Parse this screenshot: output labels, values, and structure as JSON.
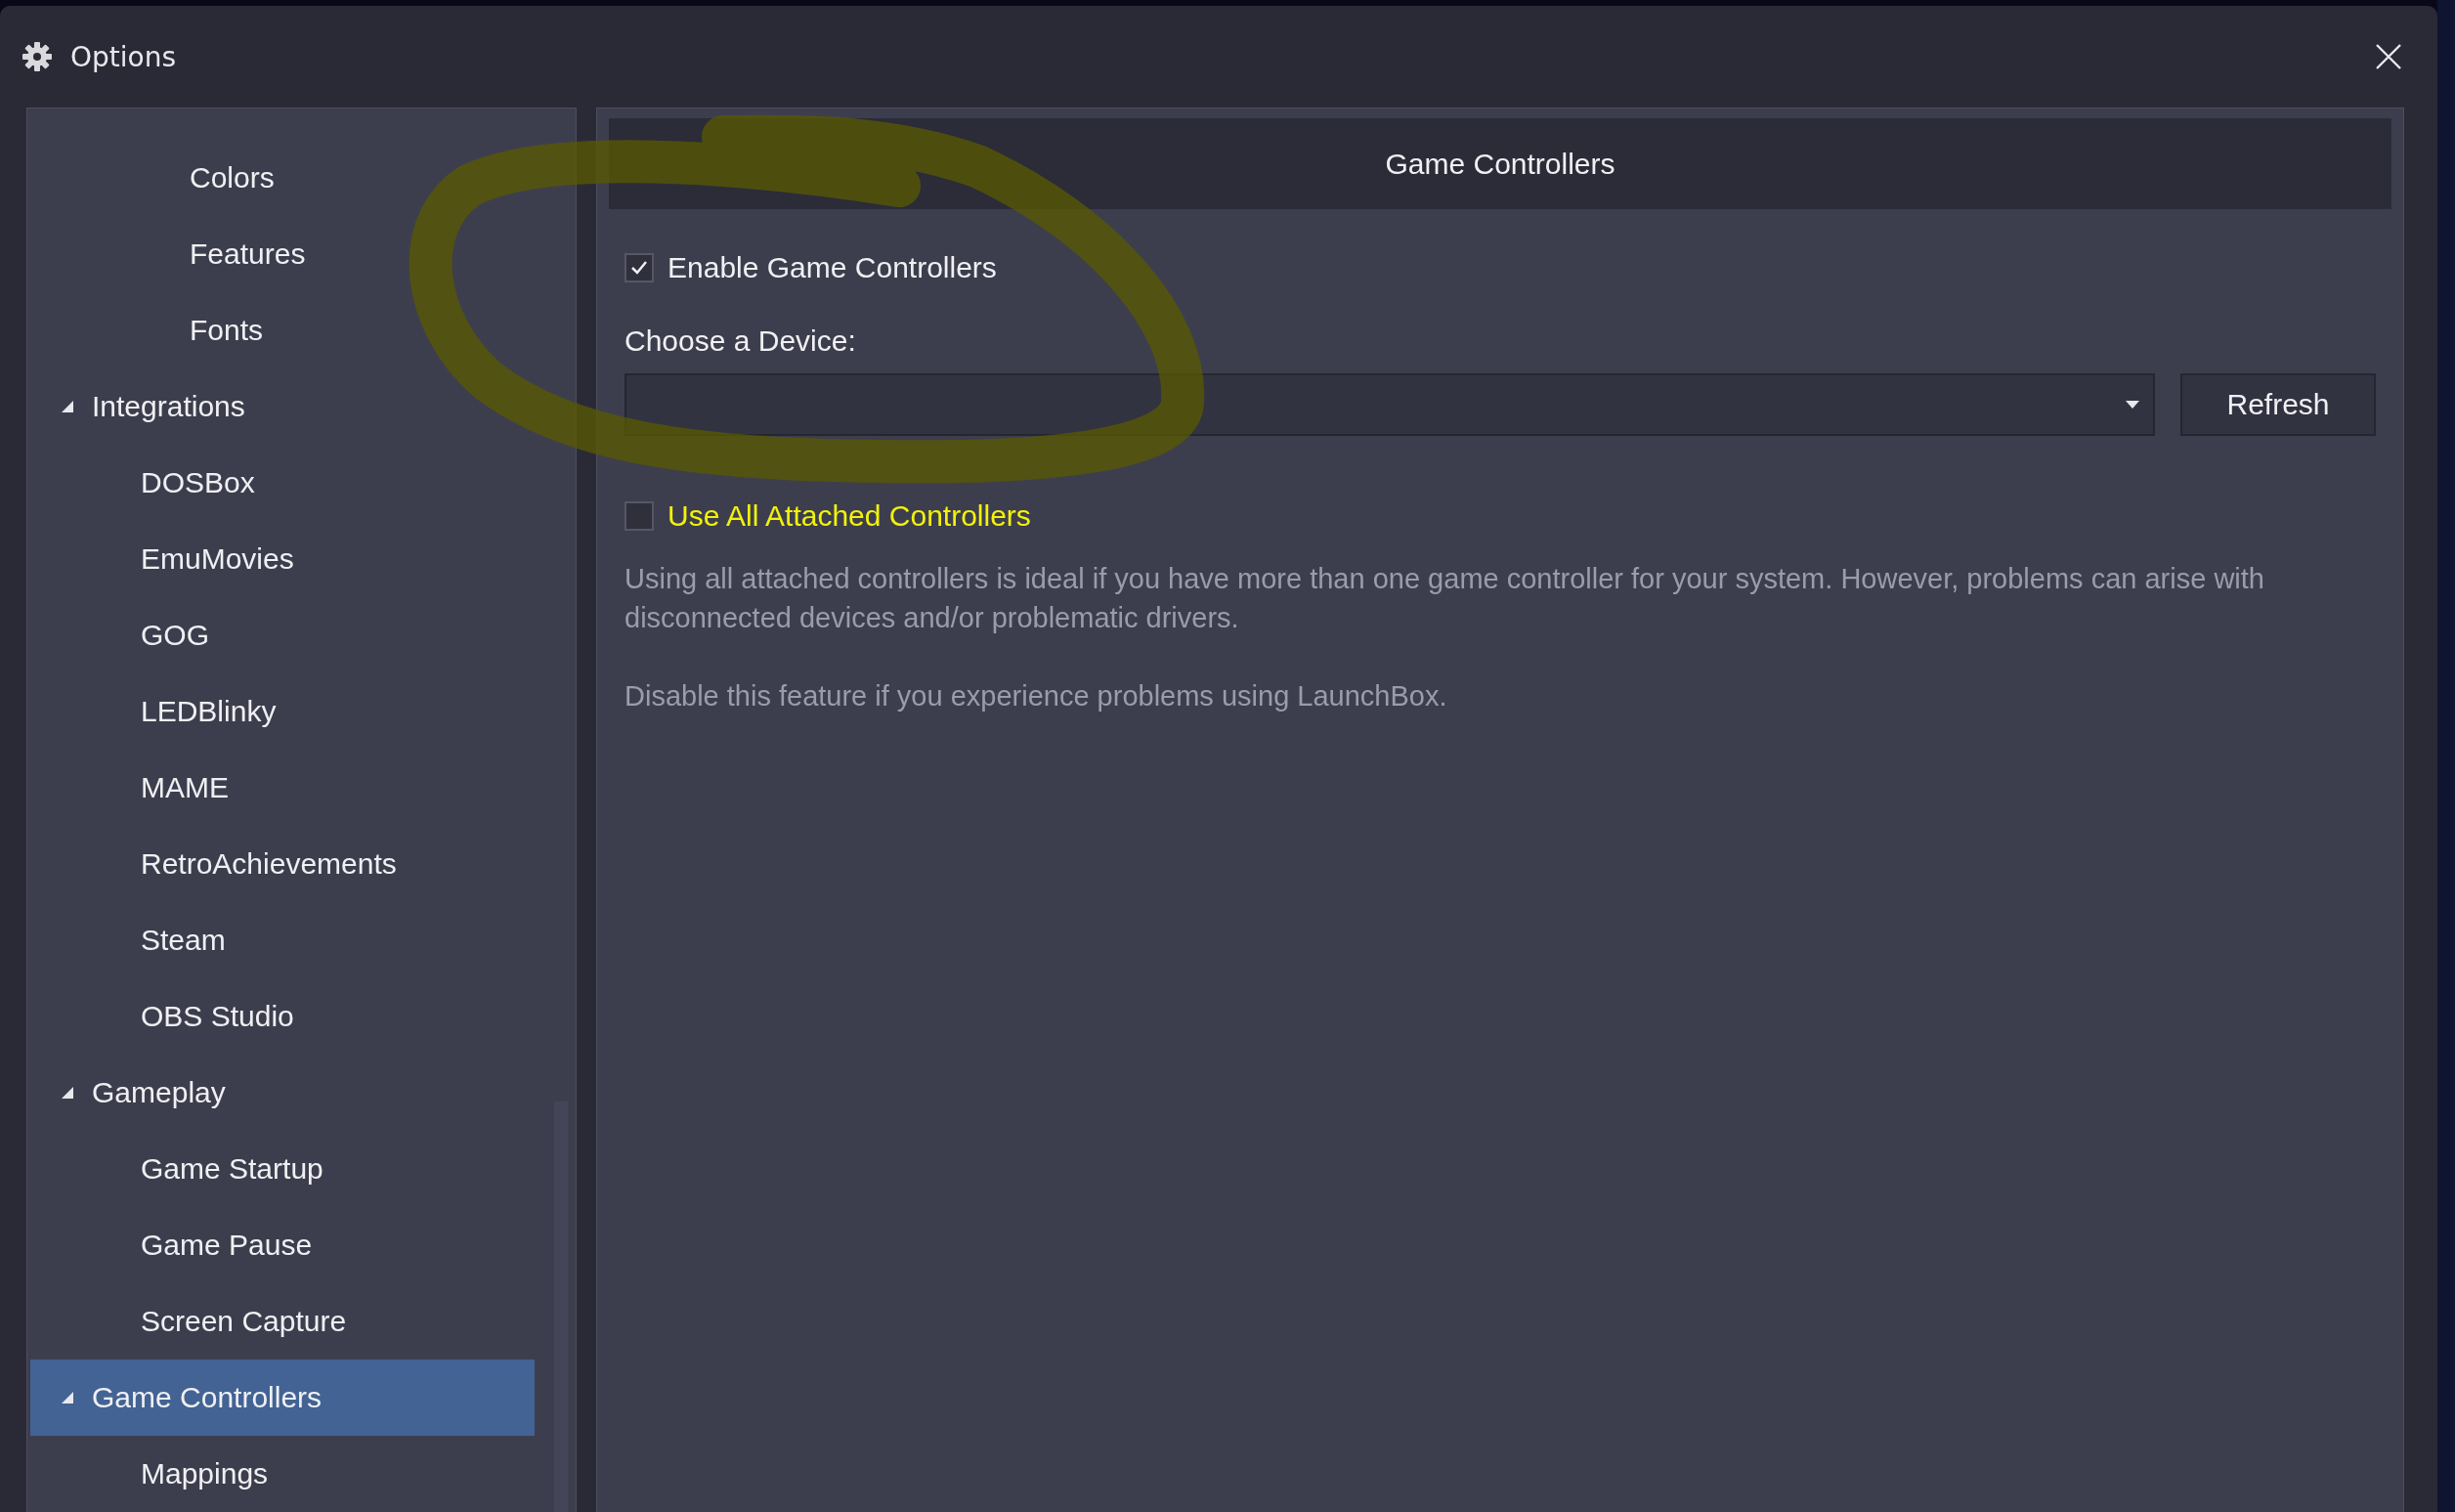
{
  "window": {
    "title": "Options"
  },
  "sidebar": {
    "continued_items": [
      {
        "label": "Colors",
        "selected": false
      },
      {
        "label": "Features",
        "selected": false
      },
      {
        "label": "Fonts",
        "selected": false
      }
    ],
    "tree": [
      {
        "label": "Integrations",
        "expanded": true,
        "selected": false,
        "children": [
          {
            "label": "DOSBox",
            "selected": false
          },
          {
            "label": "EmuMovies",
            "selected": false
          },
          {
            "label": "GOG",
            "selected": false
          },
          {
            "label": "LEDBlinky",
            "selected": false
          },
          {
            "label": "MAME",
            "selected": false
          },
          {
            "label": "RetroAchievements",
            "selected": false
          },
          {
            "label": "Steam",
            "selected": false
          },
          {
            "label": "OBS Studio",
            "selected": false
          }
        ]
      },
      {
        "label": "Gameplay",
        "expanded": true,
        "selected": false,
        "children": [
          {
            "label": "Game Startup",
            "selected": false
          },
          {
            "label": "Game Pause",
            "selected": false
          },
          {
            "label": "Screen Capture",
            "selected": false
          }
        ]
      },
      {
        "label": "Game Controllers",
        "expanded": true,
        "selected": true,
        "children": [
          {
            "label": "Mappings",
            "selected": false
          }
        ]
      }
    ]
  },
  "panel": {
    "header": "Game Controllers",
    "enable_checkbox": {
      "label": "Enable Game Controllers",
      "checked": true,
      "highlighted": false
    },
    "device_label": "Choose a Device:",
    "refresh_button": "Refresh",
    "use_all_checkbox": {
      "label": "Use All Attached Controllers",
      "checked": false,
      "highlighted": true
    },
    "help_texts": [
      "Using all attached controllers is ideal if you have more than one game controller for your system. However, problems can arise with disconnected devices and/or problematic drivers.",
      "Disable this feature if you experience problems using LaunchBox."
    ]
  },
  "annotation": {
    "color": "#5a5a00"
  }
}
